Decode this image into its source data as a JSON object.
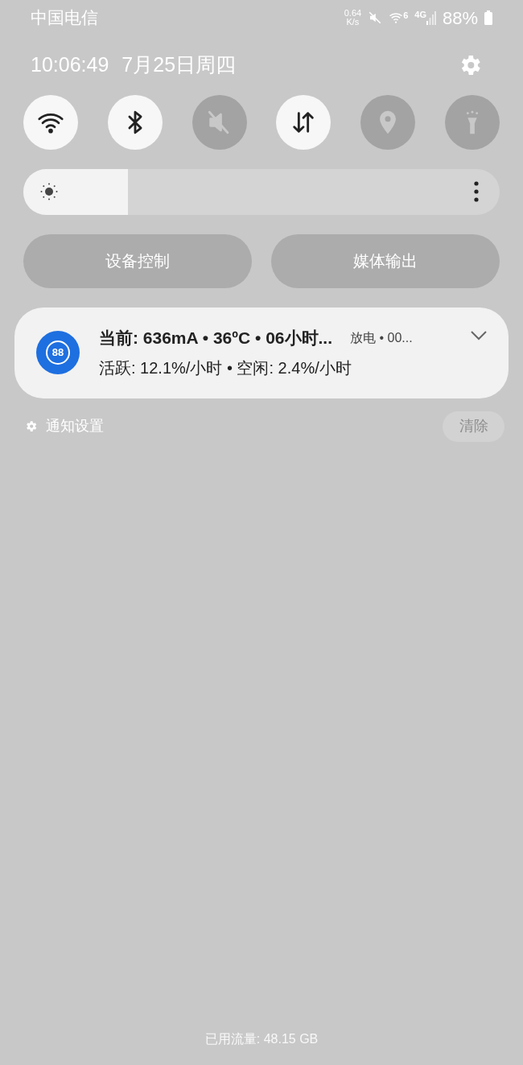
{
  "status_bar": {
    "carrier": "中国电信",
    "speed_value": "0.64",
    "speed_unit": "K/s",
    "wifi_badge": "6",
    "network_type": "4G",
    "battery": "88%"
  },
  "header": {
    "time": "10:06:49",
    "date": "7月25日周四"
  },
  "quick_toggles": [
    {
      "kind": "wifi",
      "on": true
    },
    {
      "kind": "bluetooth",
      "on": true
    },
    {
      "kind": "mute",
      "on": false
    },
    {
      "kind": "data",
      "on": true
    },
    {
      "kind": "location",
      "on": false
    },
    {
      "kind": "flashlight",
      "on": false
    }
  ],
  "brightness": {
    "level": 0.22
  },
  "shortcuts": [
    "设备控制",
    "媒体输出"
  ],
  "notification": {
    "badge": "88",
    "title": "当前: 636mA • 36ºC • 06小时...",
    "meta": "放电 • 00...",
    "body": "活跃: 12.1%/小时 • 空闲: 2.4%/小时",
    "expanded": false
  },
  "notification_settings": "通知设置",
  "clear_button": {
    "label": "清除",
    "disabled": true
  },
  "footer": "已用流量: 48.15 GB"
}
